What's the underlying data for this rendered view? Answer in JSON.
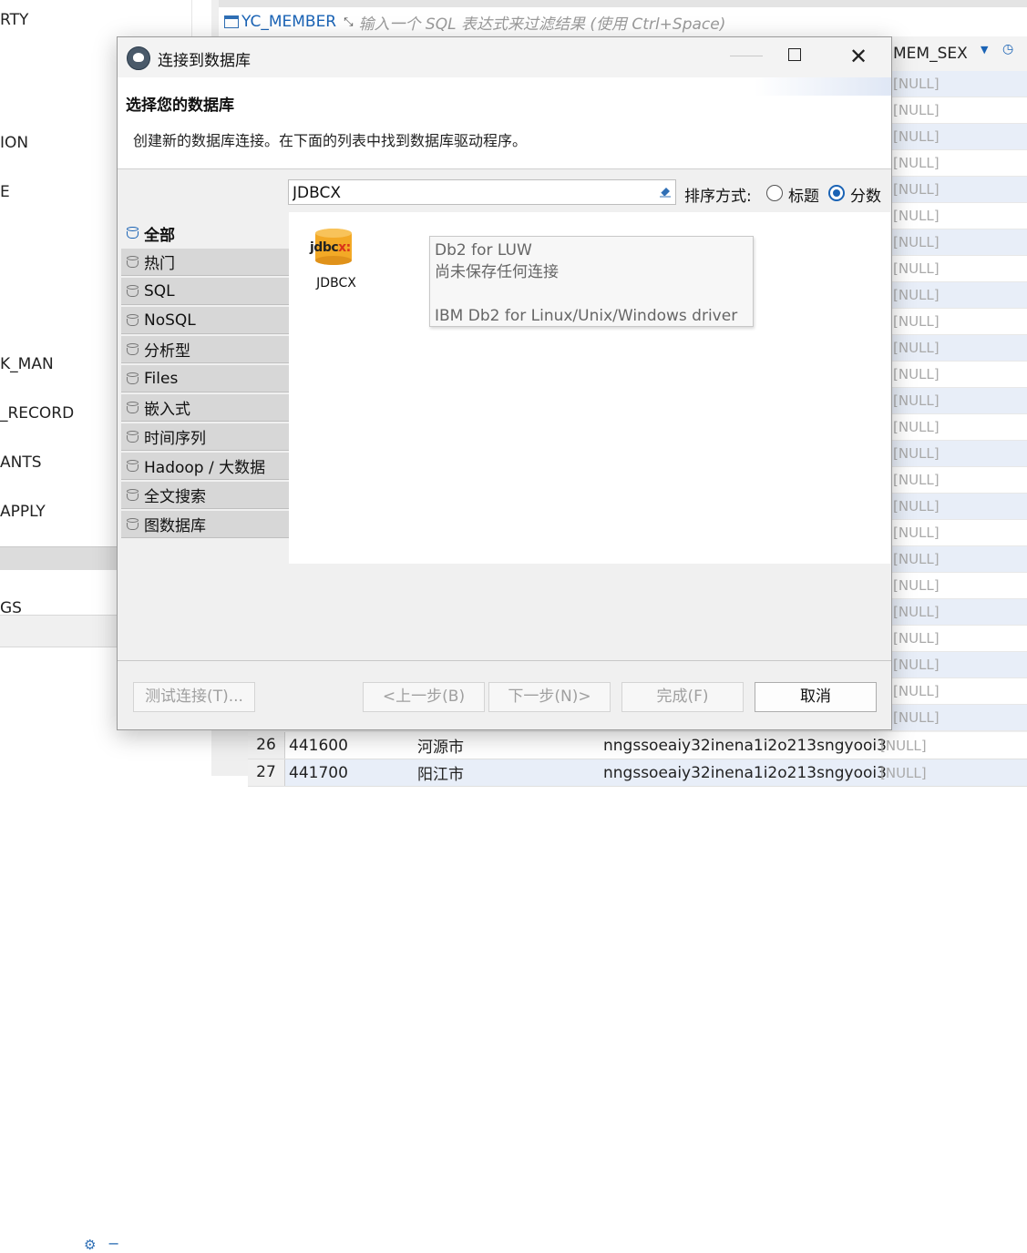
{
  "background": {
    "left_items": [
      "RTY",
      "ION",
      "E",
      "K_MAN",
      "_RECORD",
      "ANTS",
      "APPLY",
      "GS"
    ],
    "table_name": "YC_MEMBER",
    "filter_placeholder": "输入一个 SQL 表达式来过滤结果 (使用 Ctrl+Space)",
    "column_header": "MEM_SEX",
    "null_text": "[NULL]",
    "bottom_rows": [
      {
        "num": "26",
        "code": "441600",
        "city": "河源市",
        "str": "nngssoeaiy32inena1i2o213sngyooi3",
        "null": "[NULL]"
      },
      {
        "num": "27",
        "code": "441700",
        "city": "阳江市",
        "str": "nngssoeaiy32inena1i2o213sngyooi3",
        "null": "[NULL]"
      }
    ]
  },
  "dialog": {
    "title": "连接到数据库",
    "header_title": "选择您的数据库",
    "header_desc": "创建新的数据库连接。在下面的列表中找到数据库驱动程序。",
    "search_value": "JDBCX",
    "sort_label": "排序方式:",
    "sort_options": [
      {
        "label": "标题",
        "checked": false
      },
      {
        "label": "分数",
        "checked": true
      }
    ],
    "categories": [
      "全部",
      "热门",
      "SQL",
      "NoSQL",
      "分析型",
      "Files",
      "嵌入式",
      "时间序列",
      "Hadoop / 大数据",
      "全文搜索",
      "图数据库"
    ],
    "driver": {
      "logo_text": "jdbc",
      "logo_x": "x:",
      "label": "JDBCX"
    },
    "tooltip": {
      "line1": "Db2 for LUW",
      "line2": "尚未保存任何连接",
      "line3": "IBM Db2 for Linux/Unix/Windows driver"
    },
    "buttons": {
      "test": "测试连接(T)...",
      "back": "<上一步(B)",
      "next": "下一步(N)>",
      "finish": "完成(F)",
      "cancel": "取消"
    }
  }
}
